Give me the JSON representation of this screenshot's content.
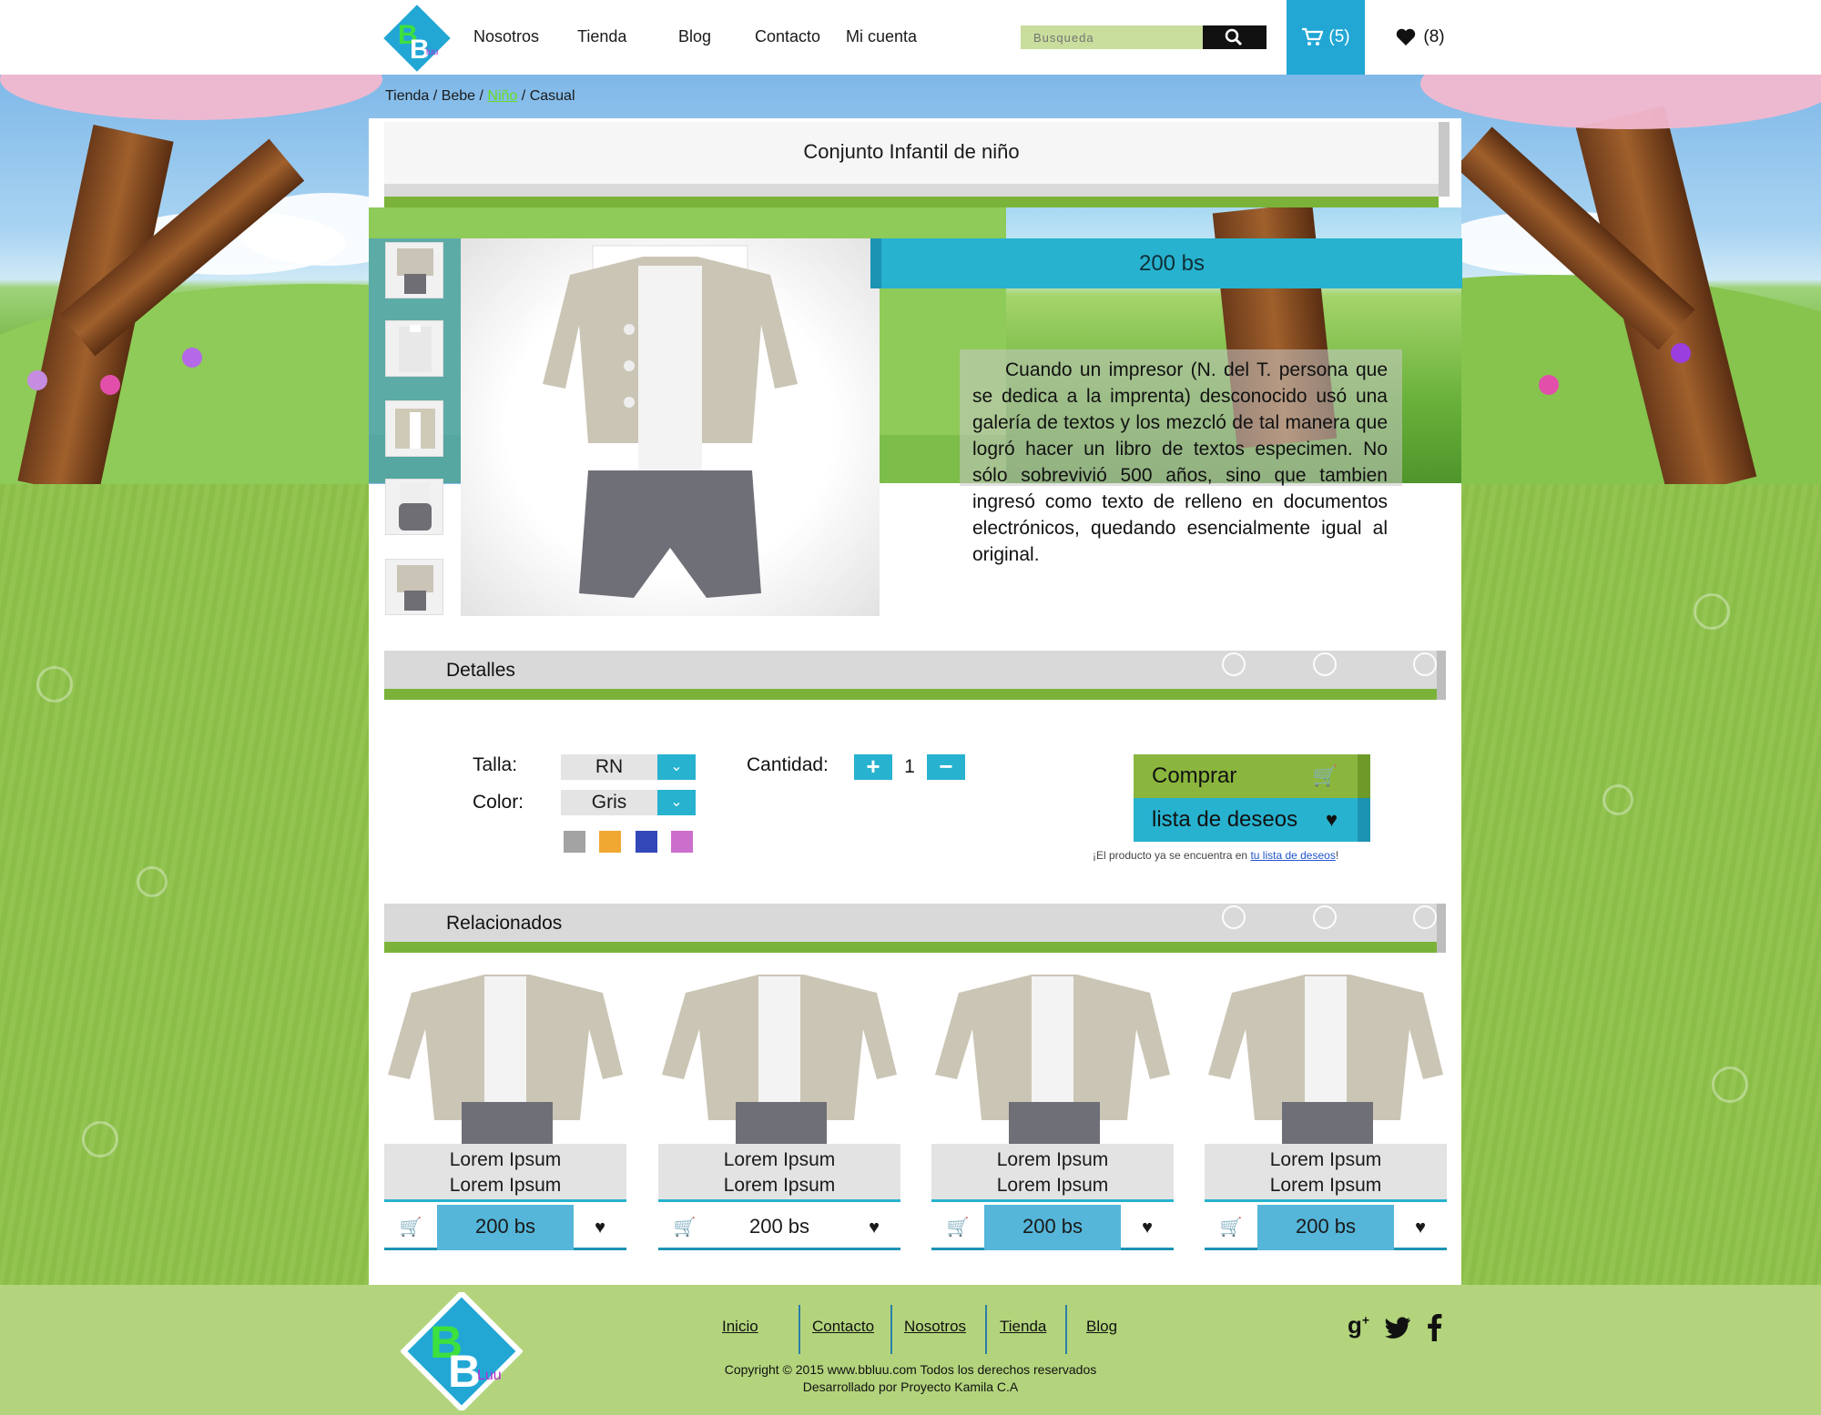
{
  "header": {
    "logo_text": "BBluu",
    "nav": [
      "Nosotros",
      "Tienda",
      "Blog",
      "Contacto",
      "Mi cuenta"
    ],
    "search_placeholder": "Busqueda",
    "cart_count": "(5)",
    "wishlist_count": "(8)"
  },
  "breadcrumb": {
    "items": [
      "Tienda",
      "Bebe",
      "Niño",
      "Casual"
    ],
    "separator": "/"
  },
  "product": {
    "title": "Conjunto Infantil de niño",
    "price": "200 bs",
    "description": "Cuando un impresor (N. del T. persona que se dedica a la imprenta) desconocido usó una galería de textos y los mezcló de tal manera que logró hacer un libro de textos especimen. No sólo sobrevivió 500 años, sino que tambien ingresó como texto de relleno en documentos electrónicos, quedando esencialmente igual al original."
  },
  "details": {
    "section_title": "Detalles",
    "size_label": "Talla:",
    "size_value": "RN",
    "color_label": "Color:",
    "color_value": "Gris",
    "swatches": [
      "#a3a3a3",
      "#f0a833",
      "#3447b8",
      "#cc6ecb"
    ],
    "quantity_label": "Cantidad:",
    "quantity_value": "1",
    "buy_label": "Comprar",
    "wishlist_label": "lista de deseos",
    "wishlist_note_prefix": "¡El producto ya se encuentra en ",
    "wishlist_note_link": "tu lista de deseos",
    "wishlist_note_suffix": "!"
  },
  "related": {
    "section_title": "Relacionados",
    "items": [
      {
        "name_line1": "Lorem Ipsum",
        "name_line2": "Lorem Ipsum",
        "price": "200 bs"
      },
      {
        "name_line1": "Lorem Ipsum",
        "name_line2": "Lorem Ipsum",
        "price": "200 bs"
      },
      {
        "name_line1": "Lorem Ipsum",
        "name_line2": "Lorem Ipsum",
        "price": "200 bs"
      },
      {
        "name_line1": "Lorem Ipsum",
        "name_line2": "Lorem Ipsum",
        "price": "200 bs"
      }
    ]
  },
  "footer": {
    "links": [
      "Inicio",
      "Contacto",
      "Nosotros",
      "Tienda",
      "Blog"
    ],
    "copyright": "Copyright © 2015 www.bbluu.com Todos los derechos reservados",
    "developer": "Desarrollado por Proyecto Kamila C.A",
    "social": [
      "google-plus-icon",
      "twitter-icon",
      "facebook-icon"
    ]
  },
  "colors": {
    "accent_blue": "#27b2cf",
    "accent_green": "#7bb33a",
    "footer_green": "#b3d47c"
  }
}
